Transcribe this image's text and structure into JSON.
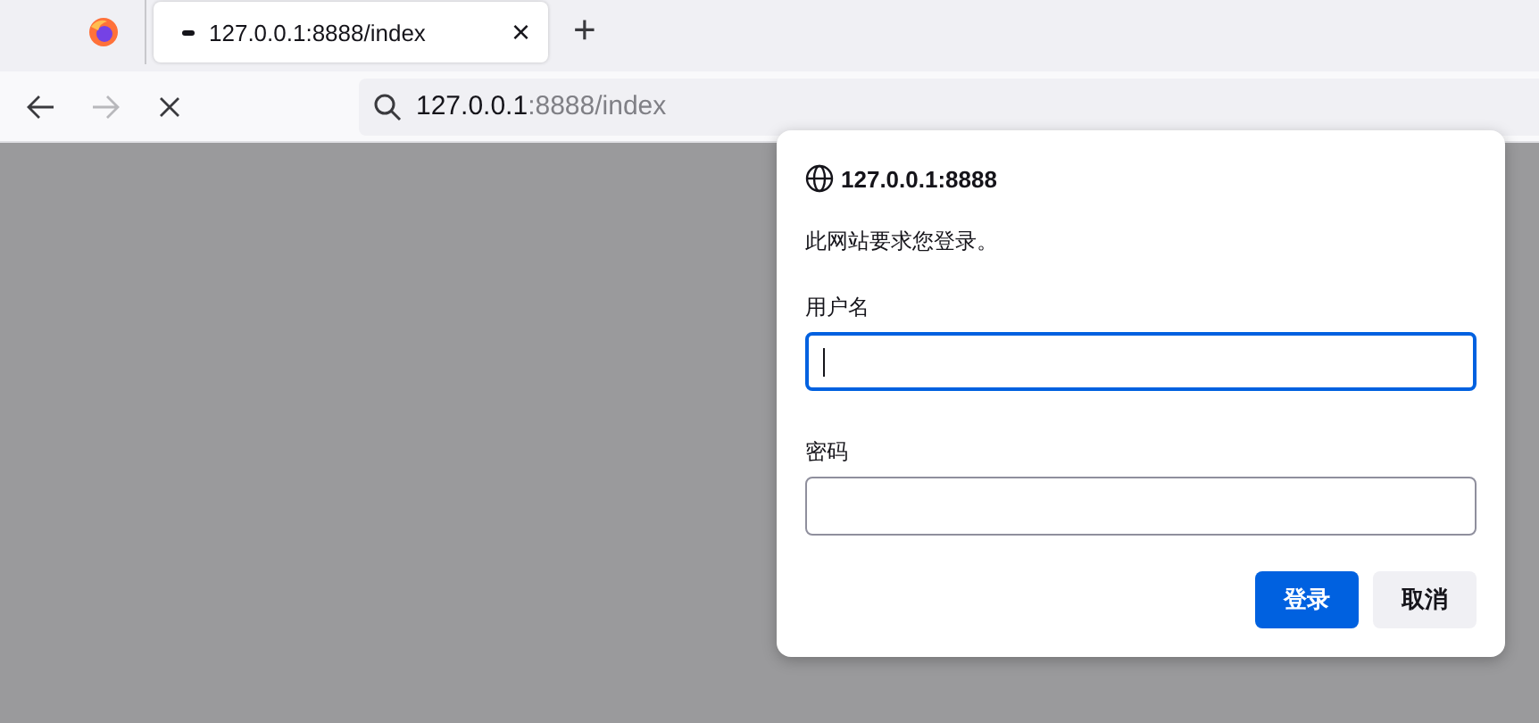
{
  "tabs": [
    {
      "kind": "pinned"
    },
    {
      "kind": "page",
      "title": "127.0.0.1:8888/index",
      "selected": true,
      "close": "×"
    }
  ],
  "new_tab": "+",
  "toolbar": {
    "back_disabled": false,
    "forward_disabled": true,
    "loading": true
  },
  "address_bar": {
    "host": "127.0.0.1",
    "path": ":8888/index"
  },
  "dialog": {
    "origin": "127.0.0.1:8888",
    "message": "此网站要求您登录。",
    "fields": [
      {
        "label": "用户名",
        "focused": true
      },
      {
        "label": "密码",
        "focused": false
      }
    ],
    "buttons": [
      {
        "label": "登录",
        "kind": "primary"
      },
      {
        "label": "取消",
        "kind": "secondary"
      }
    ]
  }
}
